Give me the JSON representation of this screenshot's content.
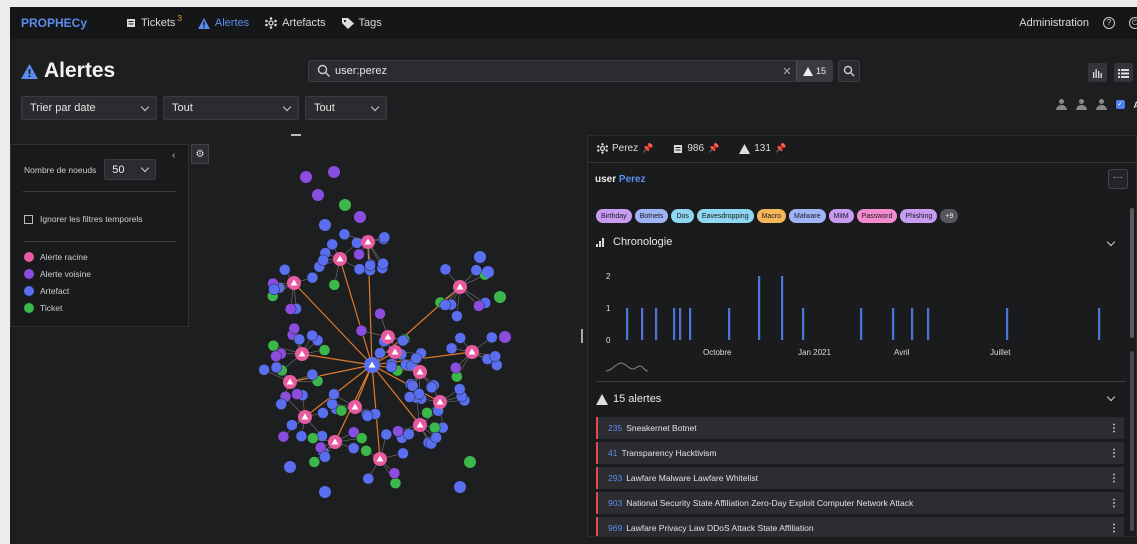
{
  "nav": {
    "brand": "PROPHECy",
    "tickets": "Tickets",
    "tickets_count": "3",
    "alertes": "Alertes",
    "artefacts": "Artefacts",
    "tags": "Tags",
    "administration": "Administration"
  },
  "page": {
    "title": "Alertes",
    "search_value": "user:perez",
    "result_count": "15"
  },
  "filters": {
    "sort": "Trier par date",
    "filter1": "Tout",
    "filter2": "Tout"
  },
  "left_panel": {
    "nodes_label": "Nombre de noeuds",
    "nodes_value": "50",
    "ignore_label": "Ignorer les filtres temporels",
    "legend": [
      {
        "label": "Alerte racine",
        "color": "#e85aa0"
      },
      {
        "label": "Alerte voisine",
        "color": "#8a4de0"
      },
      {
        "label": "Artefact",
        "color": "#5a6ef0"
      },
      {
        "label": "Ticket",
        "color": "#3cb84a"
      }
    ]
  },
  "right_panel": {
    "tab1": "Perez",
    "tab2": "986",
    "tab3": "131",
    "user_prefix": "user",
    "user_name": "Perez",
    "tags": [
      {
        "label": "Birthday",
        "color": "#c79cf2"
      },
      {
        "label": "Botnets",
        "color": "#9fb3f7"
      },
      {
        "label": "Dos",
        "color": "#8fd6f0"
      },
      {
        "label": "Eavesdropping",
        "color": "#8fd6f0"
      },
      {
        "label": "Macro",
        "color": "#f5b75a"
      },
      {
        "label": "Malware",
        "color": "#9fb3f7"
      },
      {
        "label": "MitM",
        "color": "#c79cf2"
      },
      {
        "label": "Password",
        "color": "#f28ad0"
      },
      {
        "label": "Phishing",
        "color": "#c79cf2"
      },
      {
        "label": "+9",
        "color": "#55575d"
      }
    ],
    "chrono_title": "Chronologie",
    "alerts_title": "15 alertes",
    "alerts": [
      {
        "id": "235",
        "title": "Sneakernet Botnet"
      },
      {
        "id": "41",
        "title": "Transparency Hacktivism"
      },
      {
        "id": "293",
        "title": "Lawfare Malware Lawfare Whitelist"
      },
      {
        "id": "903",
        "title": "National Security State Affiliation Zero-Day Exploit Computer Network Attack"
      },
      {
        "id": "969",
        "title": "Lawfare Privacy Law DDoS Attack State Affiliation"
      }
    ]
  },
  "chart_data": {
    "type": "bar",
    "title": "Chronologie",
    "ylim": [
      0,
      2
    ],
    "yticks": [
      "0",
      "1",
      "2"
    ],
    "xticks": [
      "Octobre",
      "Jan 2021",
      "Avril",
      "Juillet"
    ],
    "values": [
      1,
      1,
      1,
      1,
      1,
      1,
      1,
      2,
      2,
      1,
      1,
      1,
      1,
      1,
      1,
      1
    ]
  }
}
